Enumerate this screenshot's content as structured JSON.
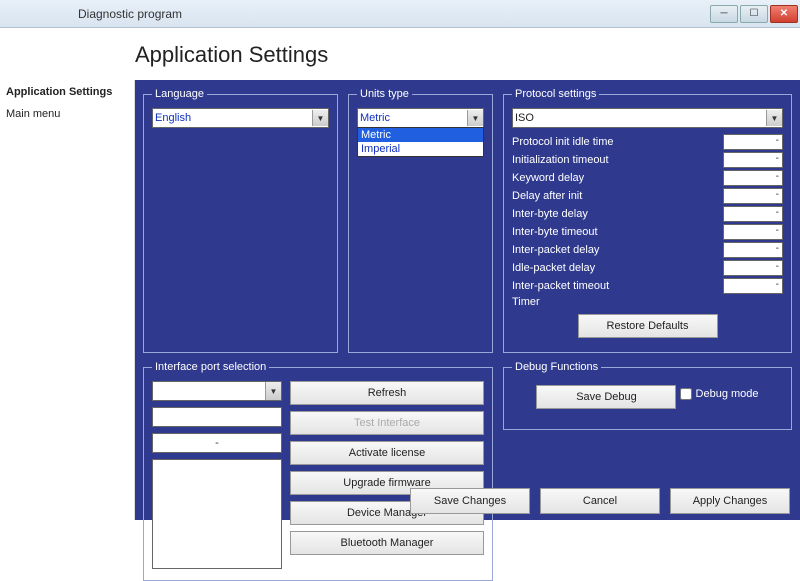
{
  "window": {
    "title": "Diagnostic program"
  },
  "heading": "Application Settings",
  "sidebar": {
    "items": [
      {
        "label": "Application Settings",
        "active": true
      },
      {
        "label": "Main menu",
        "active": false
      }
    ]
  },
  "language": {
    "legend": "Language",
    "value": "English"
  },
  "units": {
    "legend": "Units type",
    "value": "Metric",
    "options": [
      "Metric",
      "Imperial"
    ],
    "selected_index": 0
  },
  "protocol": {
    "legend": "Protocol settings",
    "value": "ISO",
    "rows": [
      {
        "label": "Protocol init idle time",
        "value": "-"
      },
      {
        "label": "Initialization timeout",
        "value": "-"
      },
      {
        "label": "Keyword delay",
        "value": "-"
      },
      {
        "label": "Delay after init",
        "value": "-"
      },
      {
        "label": "Inter-byte delay",
        "value": "-"
      },
      {
        "label": "Inter-byte timeout",
        "value": "-"
      },
      {
        "label": "Inter-packet delay",
        "value": "-"
      },
      {
        "label": "Idle-packet delay",
        "value": "-"
      },
      {
        "label": "Inter-packet timeout",
        "value": "-"
      },
      {
        "label": "Timer",
        "value": ""
      }
    ],
    "restore": "Restore Defaults"
  },
  "iface": {
    "legend": "Interface port selection",
    "port": "",
    "field2": "",
    "field3": "-",
    "buttons": {
      "refresh": "Refresh",
      "test": "Test Interface",
      "activate": "Activate license",
      "upgrade": "Upgrade firmware",
      "devmgr": "Device Manager",
      "btmgr": "Bluetooth Manager"
    }
  },
  "debug": {
    "legend": "Debug Functions",
    "save": "Save Debug",
    "mode_label": "Debug mode",
    "mode_checked": false
  },
  "bottom": {
    "save": "Save Changes",
    "cancel": "Cancel",
    "apply": "Apply Changes"
  }
}
